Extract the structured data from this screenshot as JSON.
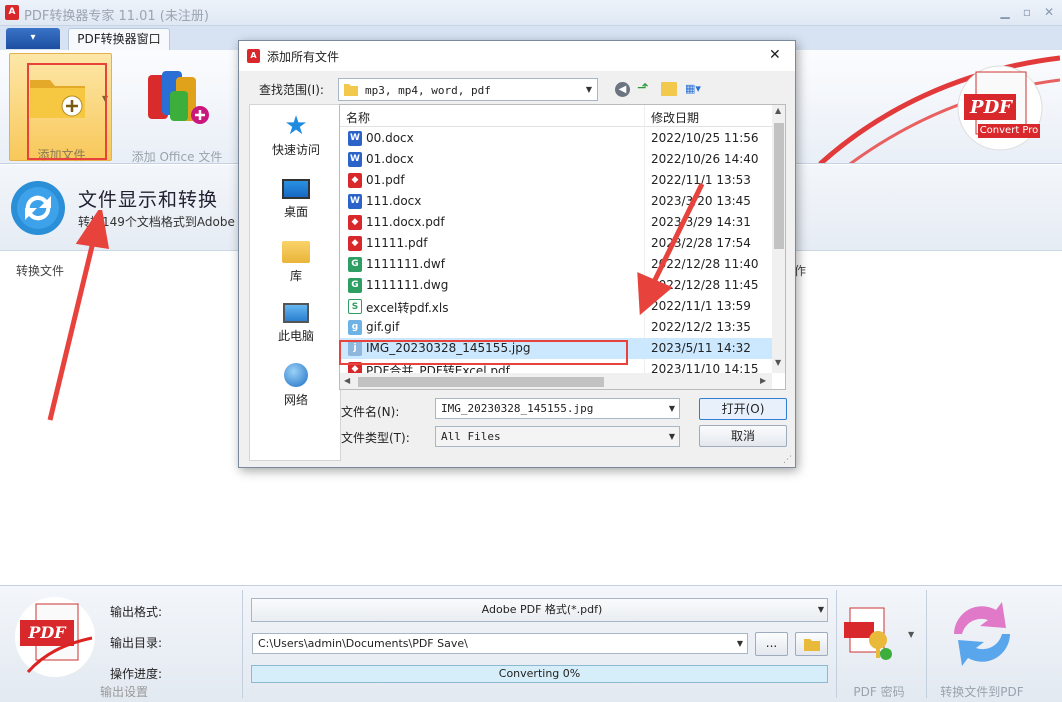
{
  "window": {
    "title": "PDF转换器专家 11.01 (未注册)"
  },
  "ribbon": {
    "tab_label": "PDF转换器窗口",
    "add_file_label": "添加文件",
    "add_office_label": "添加 Office 文件",
    "logo_text": "PDF",
    "logo_sub": "Convert Pro"
  },
  "header": {
    "title": "文件显示和转换",
    "subtitle": "转换149个文档格式到Adobe P"
  },
  "content": {
    "col_file": "转换文件",
    "col_right": "作"
  },
  "bottom": {
    "output_format_label": "输出格式:",
    "output_dir_label": "输出目录:",
    "progress_label": "操作进度:",
    "settings_label": "输出设置",
    "format_value": "Adobe PDF 格式(*.pdf)",
    "dir_value": "C:\\Users\\admin\\Documents\\PDF Save\\",
    "browse_label": "...",
    "progress_text": "Converting 0%",
    "progress": 0,
    "pdf_password_label": "PDF 密码",
    "convert_label": "转换文件到PDF"
  },
  "dialog": {
    "title": "添加所有文件",
    "close": "✕",
    "lookin_label": "查找范围(I):",
    "lookin_value": "mp3, mp4, word, pdf",
    "places": [
      "快速访问",
      "桌面",
      "库",
      "此电脑",
      "网络"
    ],
    "col_name": "名称",
    "col_date": "修改日期",
    "files": [
      {
        "name": "00.docx",
        "date": "2022/10/25 11:56",
        "type": "word"
      },
      {
        "name": "01.docx",
        "date": "2022/10/26 14:40",
        "type": "word"
      },
      {
        "name": "01.pdf",
        "date": "2022/11/1 13:53",
        "type": "pdf"
      },
      {
        "name": "111.docx",
        "date": "2023/3/20 13:45",
        "type": "word"
      },
      {
        "name": "111.docx.pdf",
        "date": "2023/3/29 14:31",
        "type": "pdf"
      },
      {
        "name": "11111.pdf",
        "date": "2023/2/28 17:54",
        "type": "pdf"
      },
      {
        "name": "1111111.dwf",
        "date": "2022/12/28 11:40",
        "type": "cad"
      },
      {
        "name": "1111111.dwg",
        "date": "2022/12/28 11:45",
        "type": "cad"
      },
      {
        "name": "excel转pdf.xls",
        "date": "2022/11/1 13:59",
        "type": "xls"
      },
      {
        "name": "gif.gif",
        "date": "2022/12/2 13:35",
        "type": "gif"
      },
      {
        "name": "IMG_20230328_145155.jpg",
        "date": "2023/5/11 14:32",
        "type": "jpg"
      },
      {
        "name": "PDF合并_PDF转Excel.pdf",
        "date": "2023/11/10 14:15",
        "type": "pdf"
      }
    ],
    "filename_label": "文件名(N):",
    "filename_value": "IMG_20230328_145155.jpg",
    "filetype_label": "文件类型(T):",
    "filetype_value": "All Files",
    "open_label": "打开(O)",
    "cancel_label": "取消"
  },
  "colors": {
    "accent_red": "#e8423c",
    "selection": "#cce8ff",
    "progress": "#9fdcf5"
  }
}
